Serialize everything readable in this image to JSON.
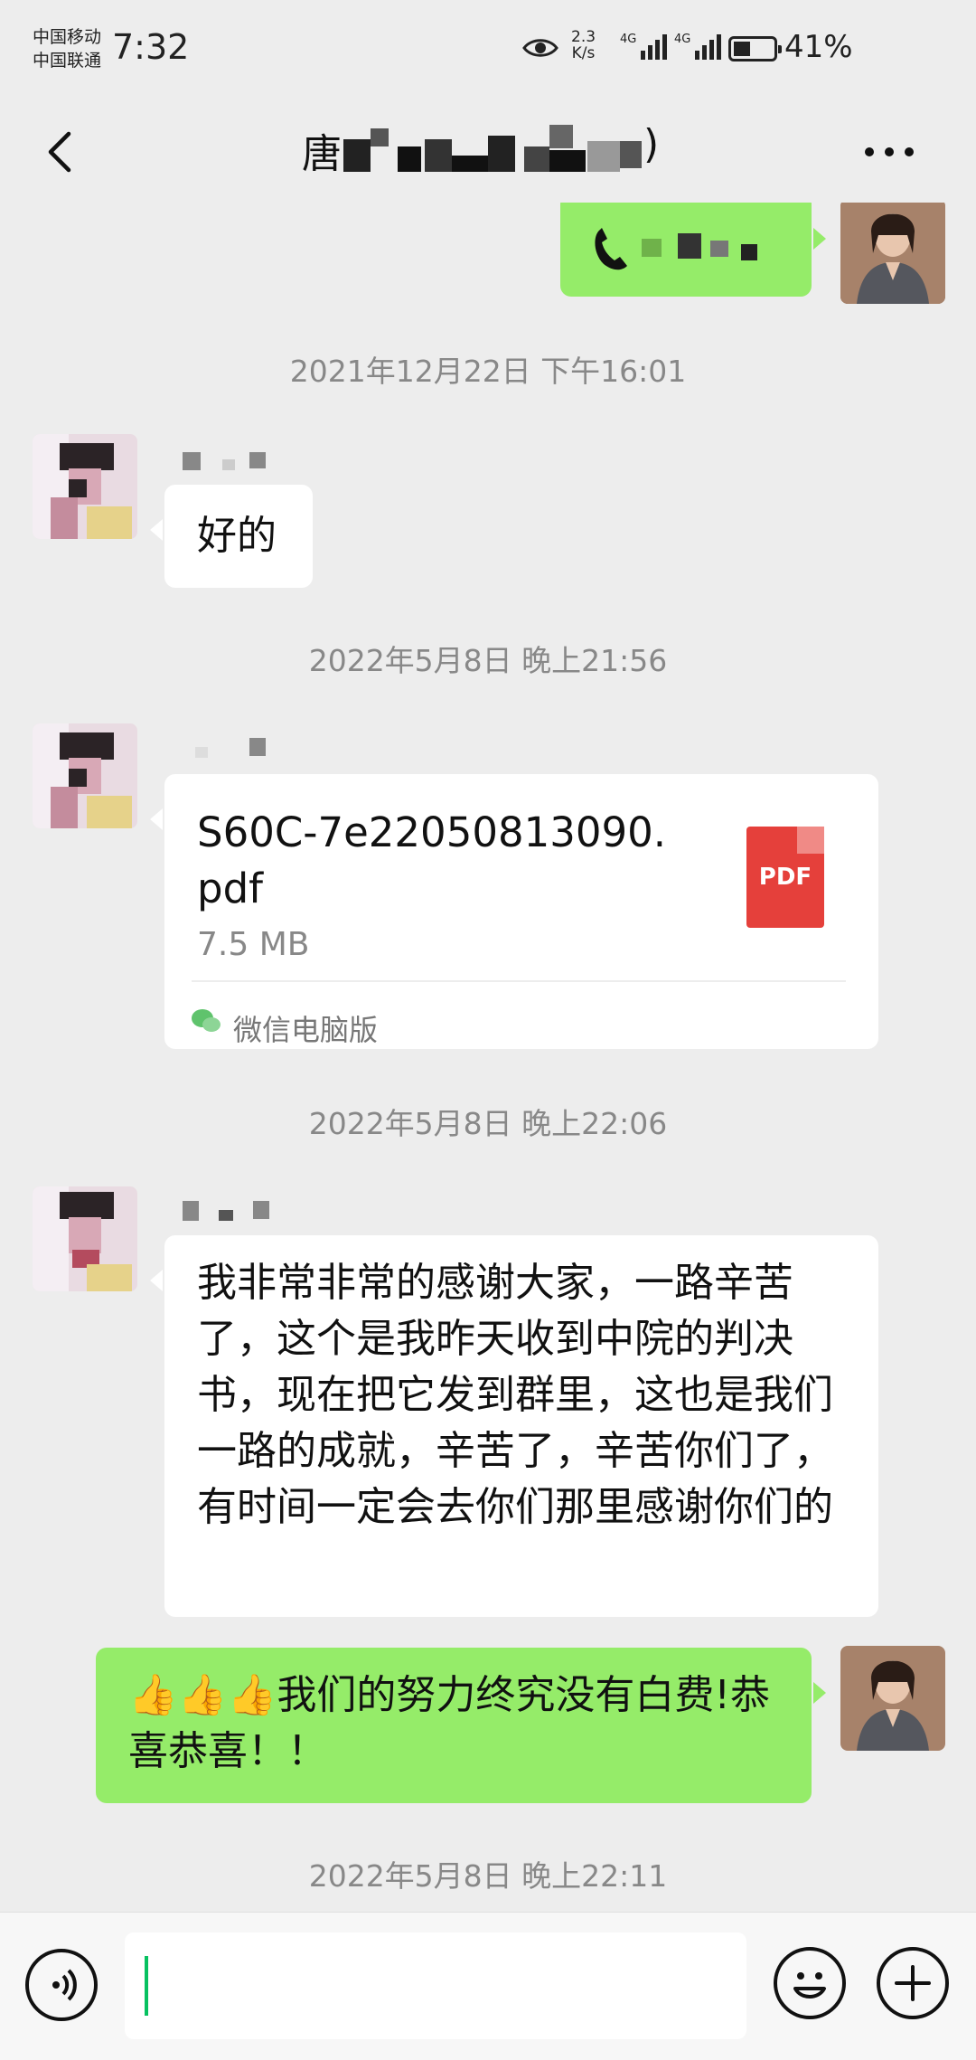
{
  "status_bar": {
    "carrier_1": "中国移动",
    "carrier_2": "中国联通",
    "time": "7:32",
    "net_speed_value": "2.3",
    "net_speed_unit": "K/s",
    "signal_1_label": "4G",
    "signal_2_label": "4G",
    "battery_percent": "41%",
    "battery_level": 0.41
  },
  "header": {
    "title": "唐",
    "title_suffix": ")",
    "back_icon": "chevron-left-icon",
    "more_icon": "more-dots-icon"
  },
  "messages": [
    {
      "type": "call",
      "direction": "out"
    },
    {
      "type": "timestamp",
      "text": "2021年12月22日 下午16:01"
    },
    {
      "type": "text",
      "direction": "in",
      "text": "好的"
    },
    {
      "type": "timestamp",
      "text": "2022年5月8日 晚上21:56"
    },
    {
      "type": "file",
      "direction": "in",
      "file_name": "S60C-7e22050813090.pdf",
      "file_size": "7.5 MB",
      "file_icon_label": "PDF",
      "source": "微信电脑版"
    },
    {
      "type": "timestamp",
      "text": "2022年5月8日 晚上22:06"
    },
    {
      "type": "text",
      "direction": "in",
      "text": "我非常非常的感谢大家，一路辛苦了，这个是我昨天收到中院的判决书，现在把它发到群里，这也是我们一路的成就，辛苦了，辛苦你们了，有时间一定会去你们那里感谢你们的"
    },
    {
      "type": "text",
      "direction": "out",
      "emoji": "👍👍👍",
      "text": "我们的努力终究没有白费!恭喜恭喜！！"
    },
    {
      "type": "timestamp",
      "text": "2022年5月8日 晚上22:11"
    }
  ],
  "input_bar": {
    "value": "",
    "voice_icon": "voice-icon",
    "emoji_icon": "emoji-icon",
    "plus_icon": "plus-icon"
  },
  "colors": {
    "background": "#ededed",
    "bubble_out": "#95ec69",
    "bubble_in": "#ffffff",
    "timestamp": "#888888",
    "pdf_red": "#e5403b",
    "caret": "#07c160"
  }
}
